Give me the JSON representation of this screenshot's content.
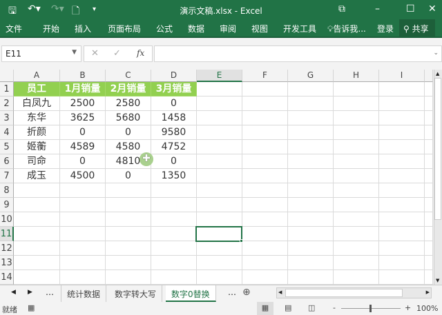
{
  "title": "演示文稿.xlsx - Excel",
  "ribbon_tabs": [
    "文件",
    "开始",
    "插入",
    "页面布局",
    "公式",
    "数据",
    "审阅",
    "视图",
    "开发工具"
  ],
  "tell_me": "告诉我...",
  "login": "登录",
  "share": "共享",
  "name_box": "E11",
  "formula": "",
  "columns": [
    "A",
    "B",
    "C",
    "D",
    "E",
    "F",
    "G",
    "H",
    "I"
  ],
  "rows": [
    "1",
    "2",
    "3",
    "4",
    "5",
    "6",
    "7",
    "8",
    "9",
    "10",
    "11",
    "12",
    "13",
    "14"
  ],
  "selected_cell": "E11",
  "table": [
    [
      "员工",
      "1月销量",
      "2月销量",
      "3月销量"
    ],
    [
      "白凤九",
      "2500",
      "2580",
      "0"
    ],
    [
      "东华",
      "3625",
      "5680",
      "1458"
    ],
    [
      "折颜",
      "0",
      "0",
      "9580"
    ],
    [
      "姬蘅",
      "4589",
      "4580",
      "4752"
    ],
    [
      "司命",
      "0",
      "4810",
      "0"
    ],
    [
      "成玉",
      "4500",
      "0",
      "1350"
    ]
  ],
  "sheet_tabs": [
    "统计数据",
    "数字转大写",
    "数字0替换"
  ],
  "active_sheet": "数字0替换",
  "status_text": "就绪",
  "zoom": "100%",
  "colors": {
    "brand": "#217346",
    "header_fill": "#92d050"
  }
}
